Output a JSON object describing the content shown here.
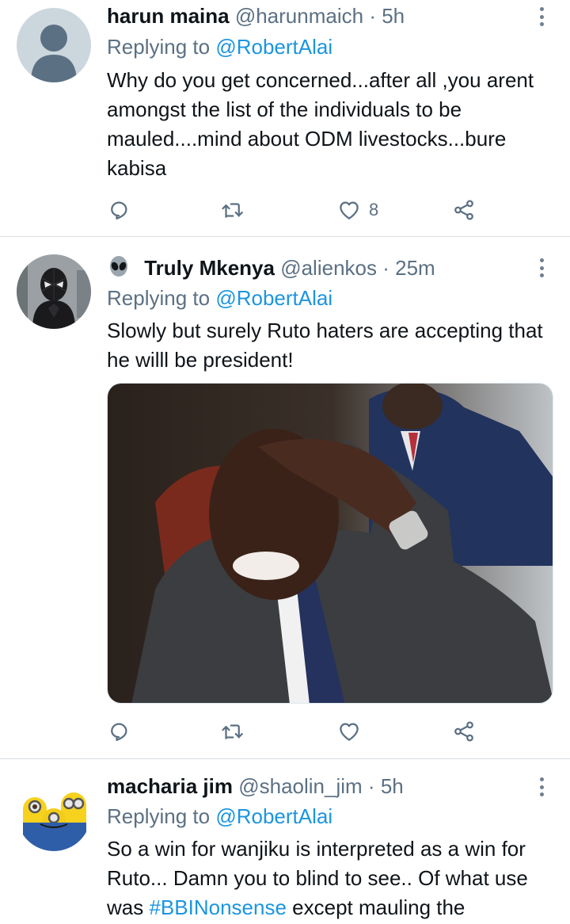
{
  "tweets": [
    {
      "name": "harun maina",
      "handle": "@harunmaich",
      "time": "5h",
      "replying_prefix": "Replying to",
      "replying_to": "@RobertAlai",
      "text": "Why do you get concerned...after all ,you arent amongst the list of the individuals to be mauled....mind about ODM livestocks...bure kabisa",
      "likes": "8",
      "avatar_icon": "default-user-avatar-icon"
    },
    {
      "name": "Truly Mkenya",
      "name_emoji_icon": "alien-icon",
      "handle": "@alienkos",
      "time": "25m",
      "replying_prefix": "Replying to",
      "replying_to": "@RobertAlai",
      "text": "Slowly but surely Ruto haters are accepting that he willl be president!",
      "likes": "",
      "avatar_icon": "spider-man-avatar-icon"
    },
    {
      "name": "macharia jim",
      "handle": "@shaolin_jim",
      "time": "5h",
      "replying_prefix": "Replying to",
      "replying_to": "@RobertAlai",
      "text_part1": "So a win for wanjiku is interpreted as a win for Ruto... Damn you to blind to see.. Of what use was ",
      "hashtag": "#BBINonsense",
      "text_part2": " except mauling the",
      "avatar_icon": "minions-avatar-icon"
    }
  ],
  "separator": "·",
  "colors": {
    "link": "#1b95e0",
    "secondary_text": "#5b7083",
    "divider": "#d9dee2"
  }
}
